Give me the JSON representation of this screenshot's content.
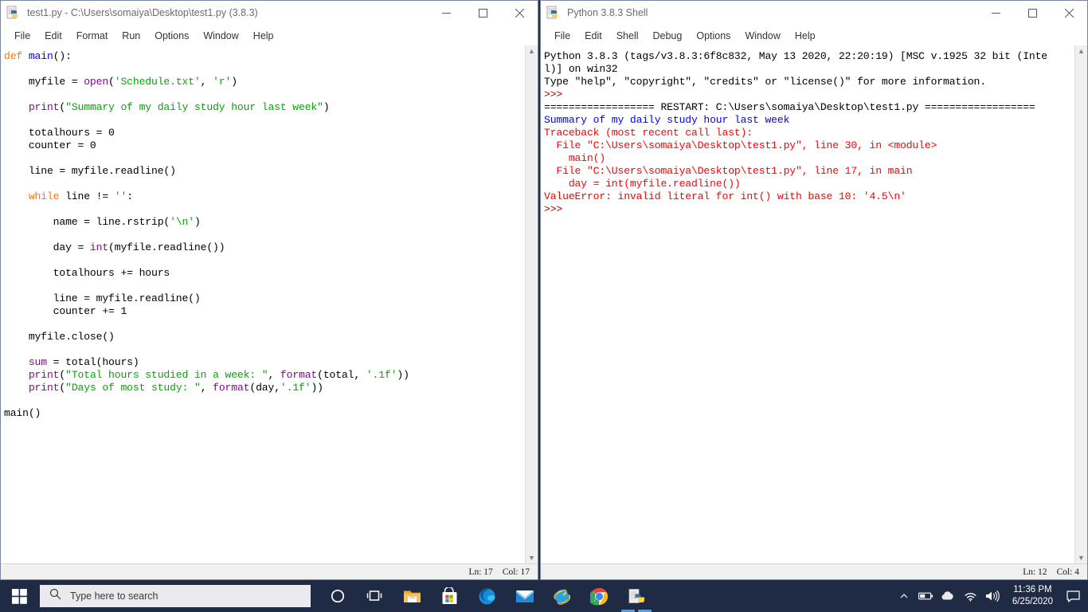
{
  "editor_window": {
    "title": "test1.py - C:\\Users\\somaiya\\Desktop\\test1.py (3.8.3)",
    "icon": "python-idle-icon",
    "menus": [
      "File",
      "Edit",
      "Format",
      "Run",
      "Options",
      "Window",
      "Help"
    ],
    "controls": {
      "minimize": "minimize-icon",
      "maximize": "maximize-icon",
      "close": "close-icon"
    },
    "status": {
      "line_label": "Ln: 17",
      "col_label": "Col: 17"
    },
    "code_lines": [
      [
        {
          "t": "def ",
          "c": "k"
        },
        {
          "t": "main",
          "c": "df"
        },
        {
          "t": "():",
          "c": ""
        }
      ],
      [],
      [
        {
          "t": "    myfile = ",
          "c": ""
        },
        {
          "t": "open",
          "c": "bi"
        },
        {
          "t": "(",
          "c": ""
        },
        {
          "t": "'Schedule.txt'",
          "c": "st"
        },
        {
          "t": ", ",
          "c": ""
        },
        {
          "t": "'r'",
          "c": "st"
        },
        {
          "t": ")",
          "c": ""
        }
      ],
      [],
      [
        {
          "t": "    ",
          "c": ""
        },
        {
          "t": "print",
          "c": "bi"
        },
        {
          "t": "(",
          "c": ""
        },
        {
          "t": "\"Summary of my daily study hour last week\"",
          "c": "st"
        },
        {
          "t": ")",
          "c": ""
        }
      ],
      [],
      [
        {
          "t": "    totalhours = 0",
          "c": ""
        }
      ],
      [
        {
          "t": "    counter = 0",
          "c": ""
        }
      ],
      [],
      [
        {
          "t": "    line = myfile.readline()",
          "c": ""
        }
      ],
      [],
      [
        {
          "t": "    ",
          "c": ""
        },
        {
          "t": "while",
          "c": "k"
        },
        {
          "t": " line != ",
          "c": ""
        },
        {
          "t": "''",
          "c": "st"
        },
        {
          "t": ":",
          "c": ""
        }
      ],
      [],
      [
        {
          "t": "        name = line.rstrip(",
          "c": ""
        },
        {
          "t": "'\\n'",
          "c": "st"
        },
        {
          "t": ")",
          "c": ""
        }
      ],
      [],
      [
        {
          "t": "        day = ",
          "c": ""
        },
        {
          "t": "int",
          "c": "bi"
        },
        {
          "t": "(myfile.readline())",
          "c": ""
        }
      ],
      [],
      [
        {
          "t": "        totalhours += hours",
          "c": ""
        }
      ],
      [],
      [
        {
          "t": "        line = myfile.readline()",
          "c": ""
        }
      ],
      [
        {
          "t": "        counter += 1",
          "c": ""
        }
      ],
      [],
      [
        {
          "t": "    myfile.close()",
          "c": ""
        }
      ],
      [],
      [
        {
          "t": "    ",
          "c": ""
        },
        {
          "t": "sum",
          "c": "bi"
        },
        {
          "t": " = total(hours)",
          "c": ""
        }
      ],
      [
        {
          "t": "    ",
          "c": ""
        },
        {
          "t": "print",
          "c": "bi"
        },
        {
          "t": "(",
          "c": ""
        },
        {
          "t": "\"Total hours studied in a week: \"",
          "c": "st"
        },
        {
          "t": ", ",
          "c": ""
        },
        {
          "t": "format",
          "c": "bi"
        },
        {
          "t": "(total, ",
          "c": ""
        },
        {
          "t": "'.1f'",
          "c": "st"
        },
        {
          "t": "))",
          "c": ""
        }
      ],
      [
        {
          "t": "    ",
          "c": ""
        },
        {
          "t": "print",
          "c": "bi"
        },
        {
          "t": "(",
          "c": ""
        },
        {
          "t": "\"Days of most study: \"",
          "c": "st"
        },
        {
          "t": ", ",
          "c": ""
        },
        {
          "t": "format",
          "c": "bi"
        },
        {
          "t": "(day,",
          "c": ""
        },
        {
          "t": "'.1f'",
          "c": "st"
        },
        {
          "t": "))",
          "c": ""
        }
      ],
      [],
      [
        {
          "t": "main()",
          "c": ""
        }
      ]
    ]
  },
  "shell_window": {
    "title": "Python 3.8.3 Shell",
    "icon": "python-idle-icon",
    "menus": [
      "File",
      "Edit",
      "Shell",
      "Debug",
      "Options",
      "Window",
      "Help"
    ],
    "controls": {
      "minimize": "minimize-icon",
      "maximize": "maximize-icon",
      "close": "close-icon"
    },
    "status": {
      "line_label": "Ln: 12",
      "col_label": "Col: 4"
    },
    "output_lines": [
      [
        {
          "t": "Python 3.8.3 (tags/v3.8.3:6f8c832, May 13 2020, 22:20:19) [MSC v.1925 32 bit (Inte",
          "c": ""
        }
      ],
      [
        {
          "t": "l)] on win32",
          "c": ""
        }
      ],
      [
        {
          "t": "Type \"help\", \"copyright\", \"credits\" or \"license()\" for more information.",
          "c": ""
        }
      ],
      [
        {
          "t": ">>> ",
          "c": "pr"
        }
      ],
      [
        {
          "t": "================== RESTART: C:\\Users\\somaiya\\Desktop\\test1.py ==================",
          "c": ""
        }
      ],
      [
        {
          "t": "Summary of my daily study hour last week",
          "c": "ou"
        }
      ],
      [
        {
          "t": "Traceback (most recent call last):",
          "c": "er"
        }
      ],
      [
        {
          "t": "  File \"C:\\Users\\somaiya\\Desktop\\test1.py\", line 30, in <module>",
          "c": "er"
        }
      ],
      [
        {
          "t": "    main()",
          "c": "er"
        }
      ],
      [
        {
          "t": "  File \"C:\\Users\\somaiya\\Desktop\\test1.py\", line 17, in main",
          "c": "er"
        }
      ],
      [
        {
          "t": "    day = int(myfile.readline())",
          "c": "er"
        }
      ],
      [
        {
          "t": "ValueError: invalid literal for int() with base 10: '4.5\\n'",
          "c": "er"
        }
      ],
      [
        {
          "t": ">>> ",
          "c": "pr"
        }
      ]
    ]
  },
  "taskbar": {
    "start_icon": "windows-logo-icon",
    "search": {
      "placeholder": "Type here to search",
      "icon": "search-icon"
    },
    "apps": [
      {
        "name": "cortana-icon",
        "label": "Cortana",
        "active": false
      },
      {
        "name": "task-view-icon",
        "label": "Task View",
        "active": false
      },
      {
        "name": "file-explorer-icon",
        "label": "File Explorer",
        "active": false
      },
      {
        "name": "microsoft-store-icon",
        "label": "Microsoft Store",
        "active": false
      },
      {
        "name": "microsoft-edge-icon",
        "label": "Microsoft Edge",
        "active": false
      },
      {
        "name": "mail-icon",
        "label": "Mail",
        "active": false
      },
      {
        "name": "internet-explorer-icon",
        "label": "Internet Explorer",
        "active": false
      },
      {
        "name": "google-chrome-icon",
        "label": "Google Chrome",
        "active": false
      },
      {
        "name": "python-idle-icon",
        "label": "IDLE (Python 3.8)",
        "active": true
      }
    ],
    "tray": [
      {
        "name": "show-hidden-icons-chevron-icon"
      },
      {
        "name": "battery-icon"
      },
      {
        "name": "onedrive-cloud-icon"
      },
      {
        "name": "wifi-icon"
      },
      {
        "name": "volume-icon"
      }
    ],
    "clock": {
      "time": "11:36 PM",
      "date": "6/25/2020"
    },
    "notifications_icon": "action-center-icon"
  },
  "colors": {
    "taskbar_bg": "#1f2a44",
    "keyword": "#ff7700",
    "builtin": "#900090",
    "string": "#00aa00",
    "defname": "#0000ff",
    "stdout": "#0000ff",
    "stderr": "#ff0000",
    "prompt": "#aa0000"
  }
}
